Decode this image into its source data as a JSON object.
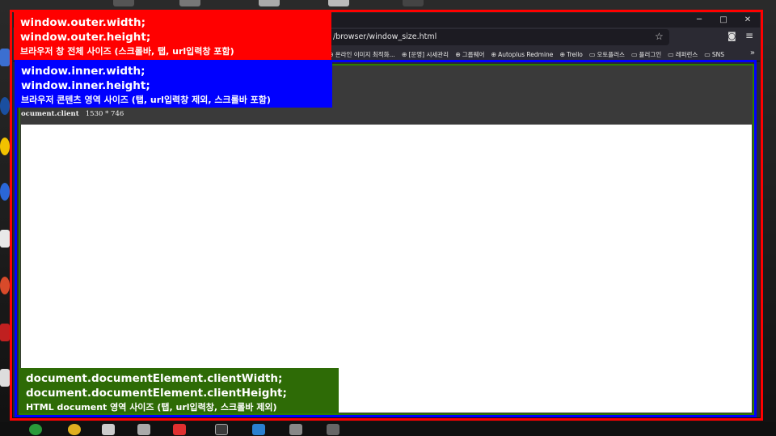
{
  "browser": {
    "url": "/browser/window_size.html",
    "window_controls": [
      "─",
      "□",
      "✕"
    ],
    "bookmarks": [
      {
        "icon": "globe-icon",
        "label": "온라인 이미지 최적화..."
      },
      {
        "icon": "globe-icon",
        "label": "[운영] 시세관리"
      },
      {
        "icon": "globe-icon",
        "label": "그룹웨어"
      },
      {
        "icon": "globe-icon",
        "label": "Autoplus Redmine"
      },
      {
        "icon": "globe-icon",
        "label": "Trello"
      },
      {
        "icon": "folder-icon",
        "label": "오토플러스"
      },
      {
        "icon": "folder-icon",
        "label": "플러그인"
      },
      {
        "icon": "folder-icon",
        "label": "레퍼런스"
      },
      {
        "icon": "folder-icon",
        "label": "SNS"
      }
    ],
    "bookmarks_more": "»"
  },
  "page": {
    "client_label": "ocument.client",
    "client_value": "1530 * 746"
  },
  "annotations": {
    "outer": {
      "line1": "window.outer.width;",
      "line2": "window.outer.height;",
      "desc": "브라우저 창 전체 사이즈 (스크롤바, 탭, url입력창 포함)",
      "color": "#ff0000"
    },
    "inner": {
      "line1": "window.inner.width;",
      "line2": "window.inner.height;",
      "desc": "브라우저 콘텐츠 영역 사이즈 (탭, url입력창 제외, 스크롤바 포함)",
      "color": "#0000ff"
    },
    "client": {
      "line1": "document.documentElement.clientWidth;",
      "line2": "document.documentElement.clientHeight;",
      "desc": "HTML document 영역 사이즈 (탭, url입력창, 스크롤바 제외)",
      "color": "#2e6b06"
    }
  }
}
